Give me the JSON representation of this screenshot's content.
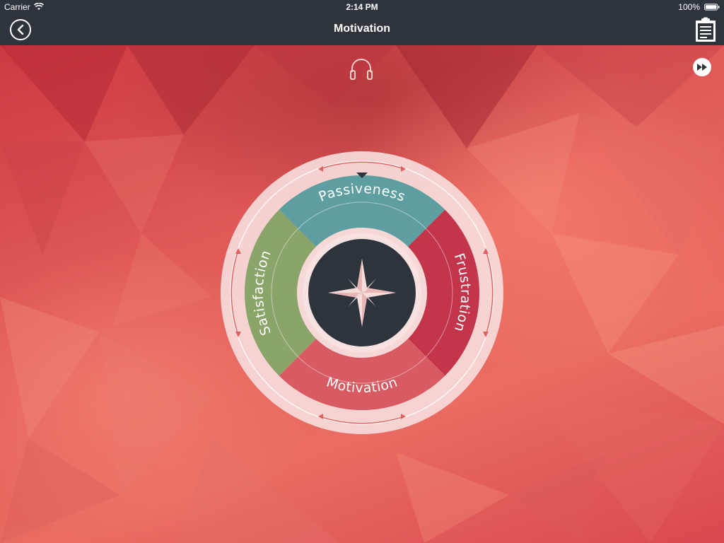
{
  "status_bar": {
    "carrier": "Carrier",
    "time": "2:14 PM",
    "battery": "100%"
  },
  "nav": {
    "title": "Motivation"
  },
  "wheel": {
    "segments": [
      {
        "label": "Passiveness",
        "color": "#5f9ea0"
      },
      {
        "label": "Frustration",
        "color": "#c2354a"
      },
      {
        "label": "Motivation",
        "color": "#d85a62"
      },
      {
        "label": "Satisfaction",
        "color": "#8aa46a"
      }
    ]
  },
  "colors": {
    "nav_background": "#2d343b",
    "hub": "#2d343b",
    "ring": "#f6dcdb",
    "accent": "#d94a4e"
  },
  "icons": {
    "back": "chevron-left-icon",
    "clipboard": "clipboard-icon",
    "headphones": "headphones-icon",
    "skip": "fast-forward-icon",
    "compass": "compass-rose-icon"
  }
}
